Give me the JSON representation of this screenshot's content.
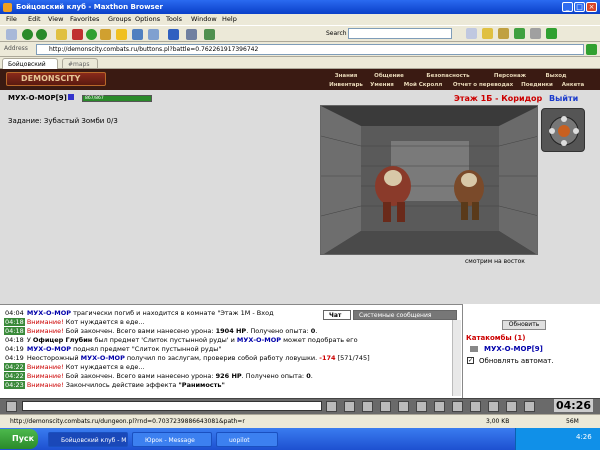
{
  "window": {
    "title": "Бойцовский клуб - Maxthon Browser"
  },
  "menubar": [
    "File",
    "Edit",
    "View",
    "Favorites",
    "Groups",
    "Options",
    "Tools",
    "Window",
    "Help"
  ],
  "toolbar": {
    "search_label": "Search"
  },
  "address": {
    "label": "Address",
    "url": "http://demonscity.combats.ru/buttons.pl?battle=0.762261917396742"
  },
  "tabs": [
    {
      "label": "Бойцовский клуб"
    },
    {
      "label": "#maps"
    }
  ],
  "game": {
    "logo": "DEMONSCITY",
    "nav_top": [
      "Знания",
      "Общение",
      "Безопасность",
      "Персонаж",
      "Выход"
    ],
    "nav_bottom": [
      "Инвентарь",
      "Умения",
      "Мой Скролл",
      "Отчет о переводах",
      "Поединки",
      "Анкета"
    ],
    "player": {
      "name": "МУХ-О-МОР",
      "level": "[9]",
      "hp": "867/867",
      "hp_fraction": 1.0
    },
    "task": "Задание: Зубастый Зомби 0/3",
    "location": "Этаж 1Б - Коридор",
    "exit_label": "Выйти",
    "view_caption": "смотрим на восток"
  },
  "chat": {
    "tabs": [
      {
        "label": "Чат"
      },
      {
        "label": "Системные сообщения"
      }
    ],
    "lines": [
      {
        "time": "04:04",
        "name": "МУХ-О-МОР",
        "text": "трагически погиб и находится в комнате \"Этаж 1М - Вход"
      },
      {
        "time": "04:18",
        "alert": "Внимание!",
        "text": "Кот нуждается в еде..."
      },
      {
        "time": "04:18",
        "alert": "Внимание!",
        "text": "Бой закончен. Всего вами нанесено урона: ",
        "v1": "1904 HP",
        "text2": ". Получено опыта: ",
        "v2": "0",
        "text3": "."
      },
      {
        "time": "04:18",
        "text": "У ",
        "name1": "Офицер Глубин",
        "text2": " был предмет 'Слиток пустынной руды' и ",
        "name": "МУХ-О-МОР",
        "text3": " может подобрать его"
      },
      {
        "time": "04:19",
        "name": "МУХ-О-МОР",
        "text": "поднял предмет \"Слиток пустынной руды\""
      },
      {
        "time": "04:19",
        "text": "Неосторожный ",
        "name": "МУХ-О-МОР",
        "text2": " получил по заслугам, проверив собой работу ловушки. ",
        "dmg": "-174",
        "text3": " [571/745]"
      },
      {
        "time": "04:22",
        "alert": "Внимание!",
        "text": "Кот нуждается в еде..."
      },
      {
        "time": "04:22",
        "alert": "Внимание!",
        "text": "Бой закончен. Всего вами нанесено урона: ",
        "v1": "926 HP",
        "text2": ". Получено опыта: ",
        "v2": "0",
        "text3": "."
      },
      {
        "time": "04:23",
        "alert": "Внимание!",
        "text": "Закончилось действие эффекта ",
        "v1": "\"Ранимость\""
      }
    ]
  },
  "room": {
    "refresh_label": "Обновить",
    "title": "Катакомбы (1)",
    "user": "МУХ-О-МОР[9]",
    "auto_label": "Обновлять автомат.",
    "auto_checked": true
  },
  "clock": "04:26",
  "status": {
    "url": "http://demonscity.combats.ru/dungeon.pl?rnd=0.7037239886643081&path=r",
    "speed": "3,00 KB",
    "memory": "56M"
  },
  "taskbar": {
    "start": "Пуск",
    "tasks": [
      {
        "label": "Бойцовский клуб - M..."
      },
      {
        "label": "Юрок - Message"
      },
      {
        "label": "uopilot"
      }
    ],
    "time": "4:26"
  },
  "colors": {
    "chat_alert": "#cc0000",
    "chat_name": "#0000aa",
    "location": "#cc0000",
    "exit": "#1a3acc",
    "hp": "#2a8a2a"
  }
}
